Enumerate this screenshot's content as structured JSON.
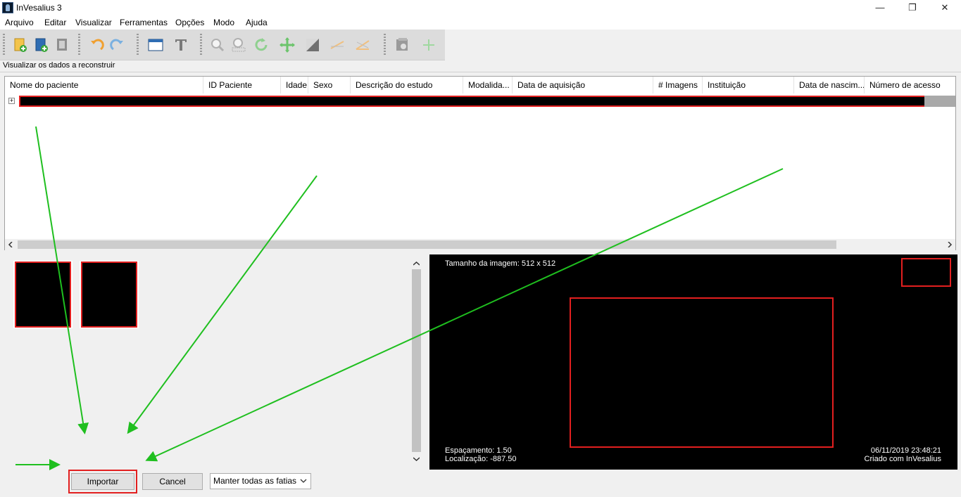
{
  "window": {
    "title": "InVesalius 3",
    "minimize": "—",
    "restore": "❐",
    "close": "✕"
  },
  "menu": [
    "Arquivo",
    "Editar",
    "Visualizar",
    "Ferramentas",
    "Opções",
    "Modo",
    "Ajuda"
  ],
  "toolbar_icons": [
    "import-dicom-icon",
    "import-other-icon",
    "open-project-icon",
    "undo-icon",
    "redo-icon",
    "window-layout-icon",
    "text-icon",
    "zoom-icon",
    "zoom-select-icon",
    "rotate-icon",
    "pan-icon",
    "contrast-icon",
    "measure-linear-icon",
    "measure-angle-icon",
    "slice-editor-icon",
    "add-icon"
  ],
  "section": {
    "label": "Visualizar os dados a reconstruir"
  },
  "table": {
    "columns": [
      "Nome do paciente",
      "ID Paciente",
      "Idade",
      "Sexo",
      "Descrição do estudo",
      "Modalida...",
      "Data de aquisição",
      "# Imagens",
      "Instituição",
      "Data de nascim...",
      "Número de acesso"
    ],
    "expander": "+"
  },
  "preview": {
    "image_size": "Tamanho da imagem: 512 x 512",
    "spacing": "Espaçamento: 1.50",
    "location": "Localização: -887.50",
    "datetime": "06/11/2019 23:48:21",
    "credit": "Criado com InVesalius"
  },
  "buttons": {
    "import": "Importar",
    "cancel": "Cancel"
  },
  "slice_option": {
    "selected": "Manter todas as fatias"
  },
  "colors": {
    "highlight": "#e21f1f",
    "arrow": "#1fbf1f"
  }
}
